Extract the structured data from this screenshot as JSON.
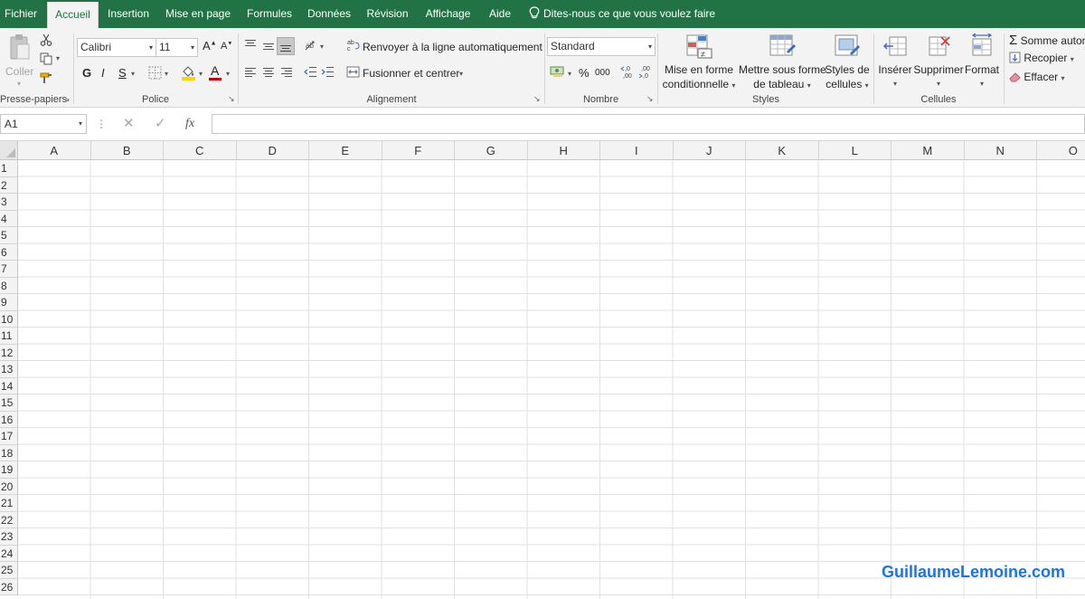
{
  "tabs": [
    {
      "label": "Fichier"
    },
    {
      "label": "Accueil"
    },
    {
      "label": "Insertion"
    },
    {
      "label": "Mise en page"
    },
    {
      "label": "Formules"
    },
    {
      "label": "Données"
    },
    {
      "label": "Révision"
    },
    {
      "label": "Affichage"
    },
    {
      "label": "Aide"
    }
  ],
  "active_tab": "Accueil",
  "tell_me": "Dites-nous ce que vous voulez faire",
  "clipboard": {
    "paste_label": "Coller",
    "group_label": "Presse-papiers"
  },
  "font": {
    "name": "Calibri",
    "size": "11",
    "bold": "G",
    "italic": "I",
    "underline": "S",
    "group_label": "Police",
    "grow": "A",
    "shrink": "A",
    "font_color_letter": "A"
  },
  "alignment": {
    "wrap_label": "Renvoyer à la ligne automatiquement",
    "merge_label": "Fusionner et centrer",
    "group_label": "Alignement"
  },
  "number": {
    "format": "Standard",
    "percent": "%",
    "thousands": "000",
    "group_label": "Nombre"
  },
  "styles": {
    "conditional": [
      "Mise en forme",
      "conditionnelle"
    ],
    "table": [
      "Mettre sous forme",
      "de tableau"
    ],
    "cell_styles": [
      "Styles de",
      "cellules"
    ],
    "group_label": "Styles"
  },
  "cells_group": {
    "insert": "Insérer",
    "delete": "Supprimer",
    "format": "Format",
    "group_label": "Cellules"
  },
  "editing": {
    "autosum": "Somme automatique",
    "fill": "Recopier",
    "clear": "Effacer"
  },
  "name_box": "A1",
  "fx_label": "fx",
  "columns": [
    "A",
    "B",
    "C",
    "D",
    "E",
    "F",
    "G",
    "H",
    "I",
    "J",
    "K",
    "L",
    "M",
    "N",
    "O"
  ],
  "rows": [
    "1",
    "2",
    "3",
    "4",
    "5",
    "6",
    "7",
    "8",
    "9",
    "10",
    "11",
    "12",
    "13",
    "14",
    "15",
    "16",
    "17",
    "18",
    "19",
    "20",
    "21",
    "22",
    "23",
    "24",
    "25",
    "26"
  ],
  "watermark": "GuillaumeLemoine.com",
  "colors": {
    "excel_green": "#217346",
    "ribbon_bg": "#f3f3f3",
    "fill_yellow": "#ffd400",
    "font_red": "#c00000",
    "watermark_blue": "#1a73e8"
  }
}
